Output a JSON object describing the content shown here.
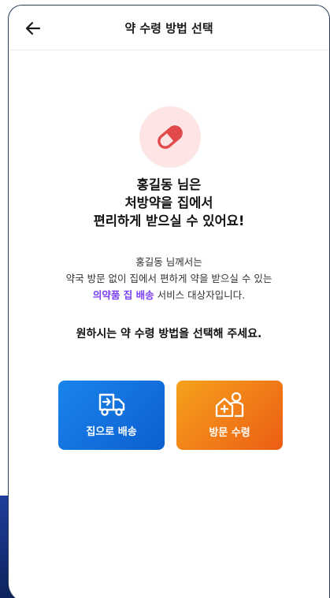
{
  "header": {
    "title": "약 수령 방법 선택"
  },
  "hero": {
    "icon": "pill-icon",
    "headline_line1": "홍길동 님은",
    "headline_line2": "처방약을 집에서",
    "headline_line3": "편리하게 받으실 수 있어요!"
  },
  "description": {
    "line1": "홍길동 님께서는",
    "line2": "약국 방문 없이 집에서 편하게 약을 받으실 수 있는",
    "highlight": "의약품 집 배송",
    "line3_rest": " 서비스 대상자입니다."
  },
  "question": "원하시는 약 수령 방법을 선택해 주세요.",
  "options": [
    {
      "label": "집으로 배송",
      "icon": "delivery-truck-icon",
      "color": "#1a84ec"
    },
    {
      "label": "방문 수령",
      "icon": "pharmacy-visit-icon",
      "color": "#f29020"
    }
  ],
  "colors": {
    "accent_purple": "#7a3ff2",
    "pill_bg": "#fde5e5",
    "pill_icon": "#e04a4a"
  }
}
